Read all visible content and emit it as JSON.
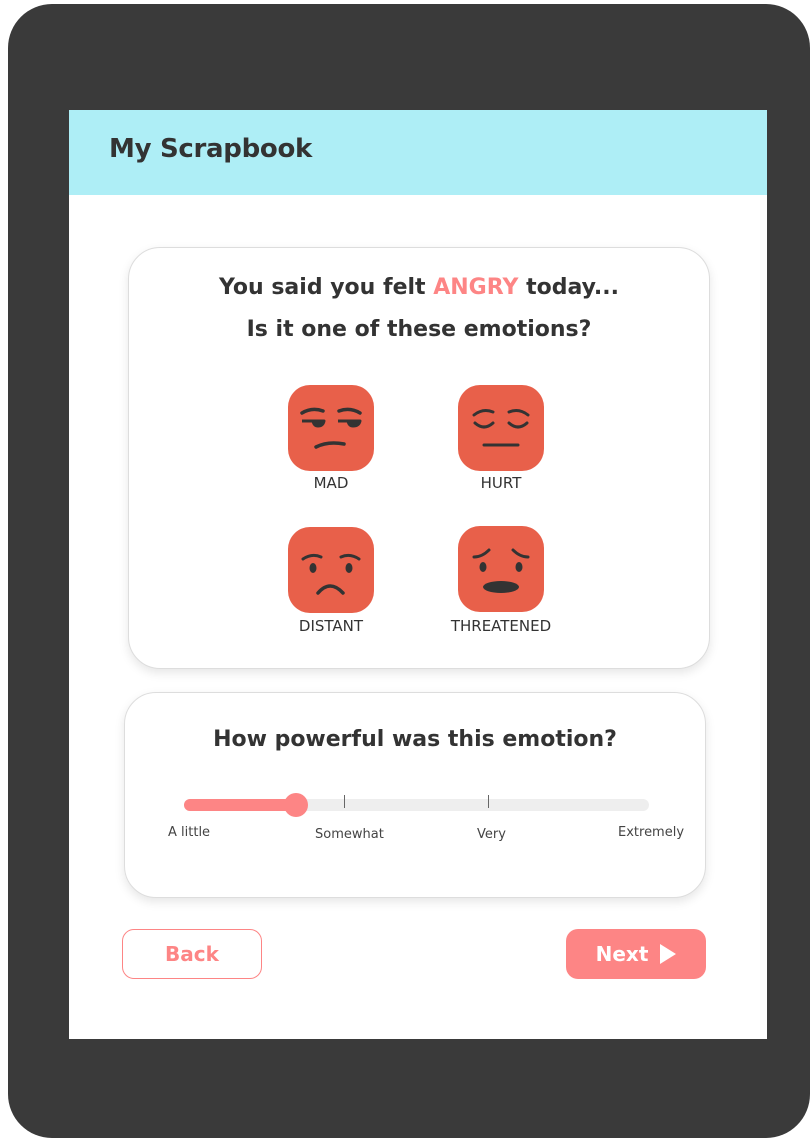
{
  "app": {
    "title": "My Scrapbook"
  },
  "emotion_card": {
    "question_prefix": "You said you felt",
    "emotion": "ANGRY",
    "question_suffix": "today...",
    "question_line2": "Is it one of these emotions?",
    "options": [
      {
        "label": "MAD",
        "icon": "mad-face-icon"
      },
      {
        "label": "HURT",
        "icon": "hurt-face-icon"
      },
      {
        "label": "DISTANT",
        "icon": "distant-face-icon"
      },
      {
        "label": "THREATENED",
        "icon": "threatened-face-icon"
      }
    ]
  },
  "intensity_card": {
    "question": "How powerful was this emotion?",
    "scale_labels": [
      "A little",
      "Somewhat",
      "Very",
      "Extremely"
    ],
    "value_fraction": 0.24
  },
  "buttons": {
    "back": "Back",
    "next": "Next"
  },
  "colors": {
    "header": "#aeeef6",
    "accent": "#fd8585",
    "face": "#e8604a",
    "device": "#3a3a3a"
  }
}
